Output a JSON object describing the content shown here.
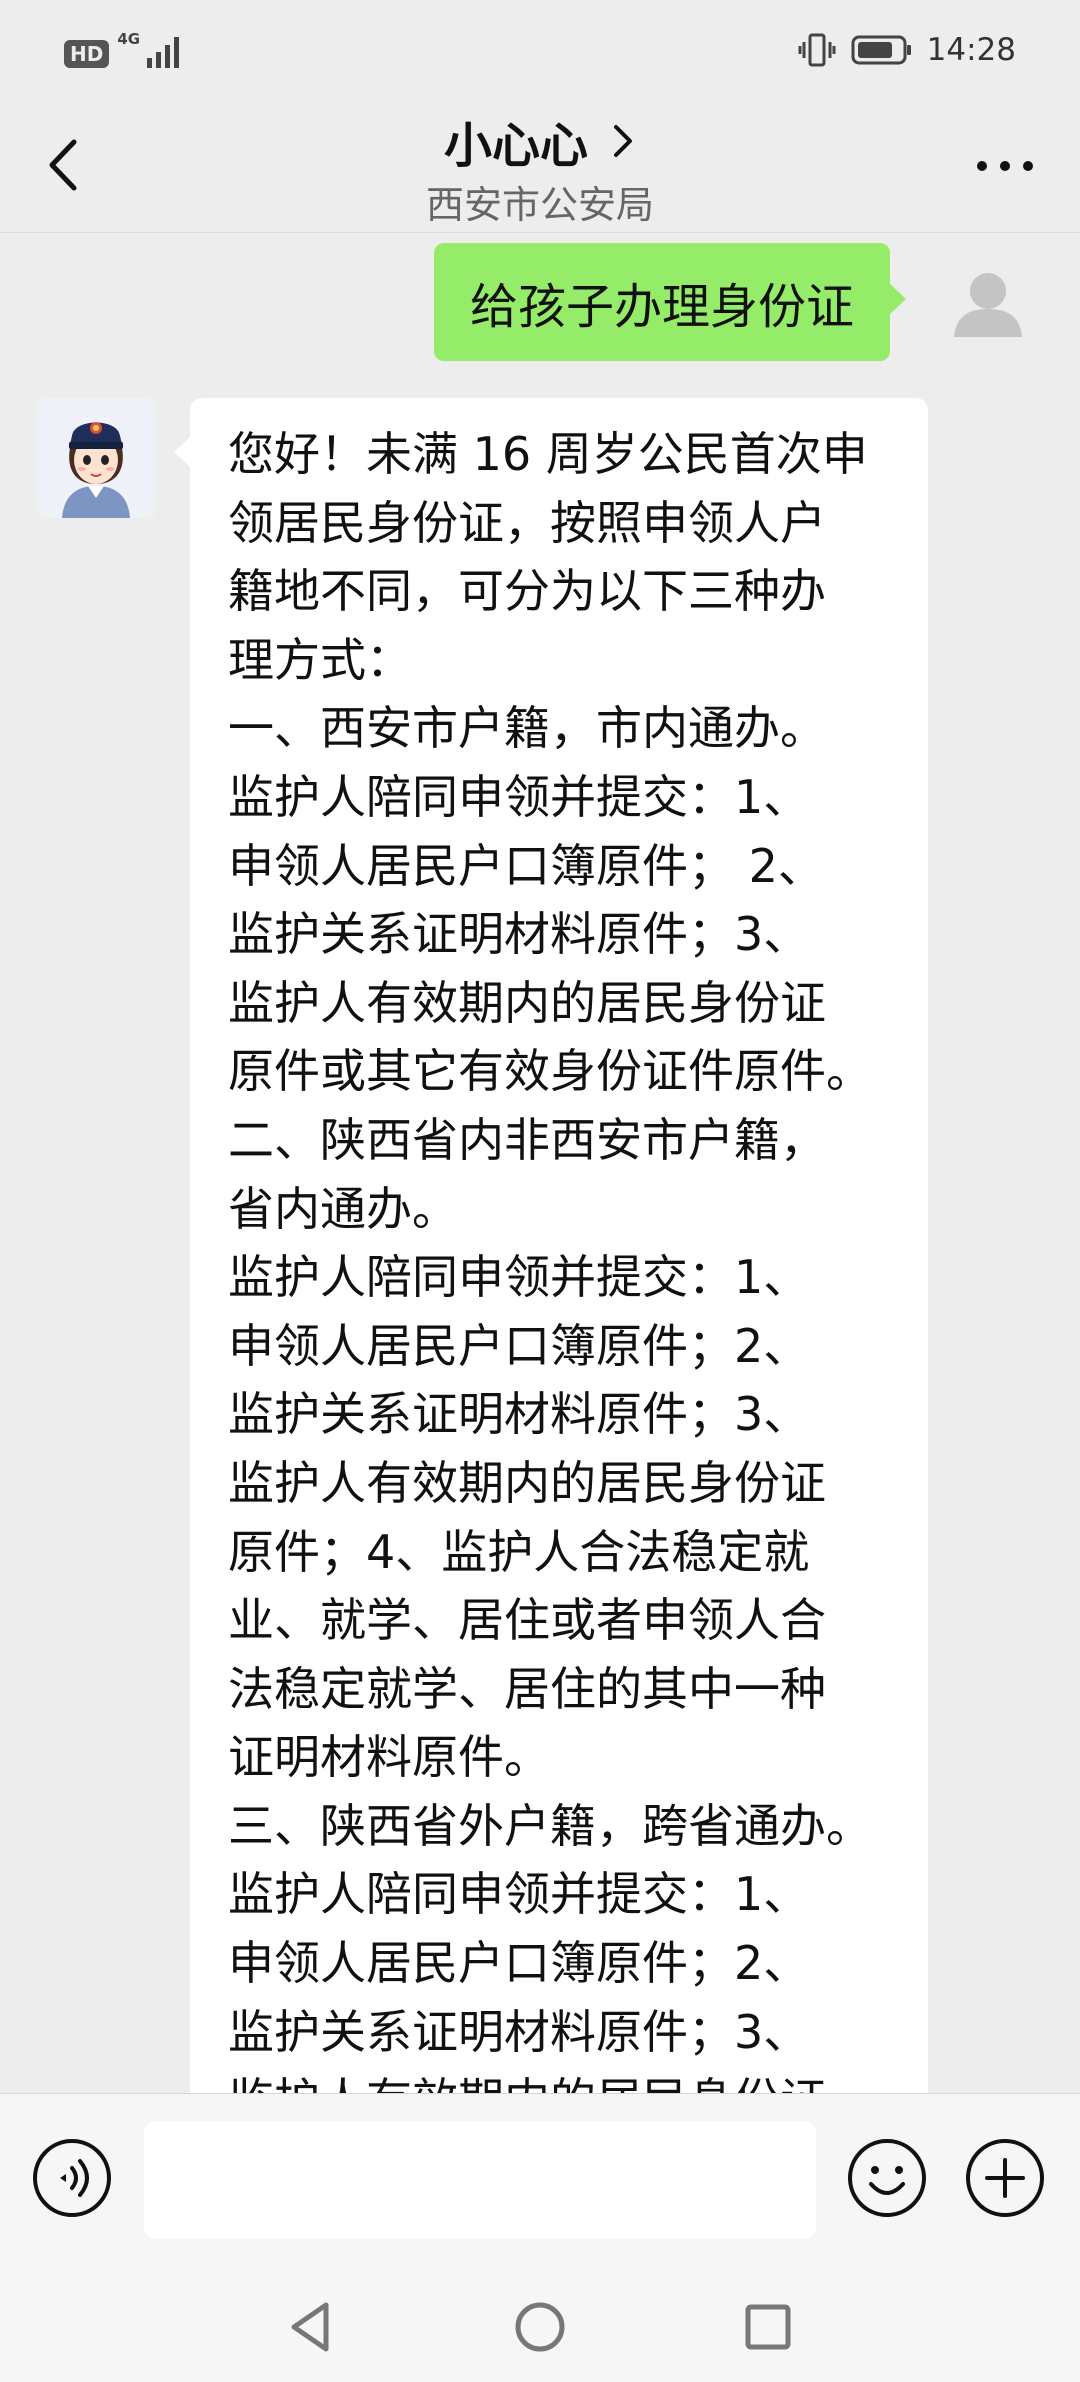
{
  "status_bar": {
    "hd_label": "HD",
    "network_label": "4G",
    "time": "14:28"
  },
  "header": {
    "title": "小心心",
    "subtitle": "西安市公安局"
  },
  "messages": {
    "outgoing_text": "给孩子办理身份证",
    "incoming_lines": [
      "您好！未满 16 周岁公民首次申",
      "领居民身份证，按照申领人户",
      "籍地不同，可分为以下三种办",
      "理方式：",
      "一、西安市户籍，市内通办。",
      "监护人陪同申领并提交：1、",
      "申领人居民户口簿原件；  2、",
      "监护关系证明材料原件；3、",
      "监护人有效期内的居民身份证",
      "原件或其它有效身份证件原件。",
      "二、陕西省内非西安市户籍，",
      "省内通办。",
      "监护人陪同申领并提交：1、",
      "申领人居民户口簿原件；2、",
      "监护关系证明材料原件；3、",
      "监护人有效期内的居民身份证",
      "原件；4、监护人合法稳定就",
      "业、就学、居住或者申领人合",
      "法稳定就学、居住的其中一种",
      "证明材料原件。",
      "三、陕西省外户籍，跨省通办。",
      "监护人陪同申领并提交：1、",
      "申领人居民户口簿原件；2、",
      "监护关系证明材料原件；3、",
      "监护人有效期内的居民身份证"
    ]
  },
  "input": {
    "value": ""
  },
  "icons": {
    "back": "chevron-left-icon",
    "title_arrow": "chevron-right-icon",
    "more": "more-dots-icon",
    "voice": "voice-icon",
    "emoji": "emoji-icon",
    "plus": "plus-icon",
    "nav_back": "triangle-back-icon",
    "nav_home": "circle-home-icon",
    "nav_recent": "square-recent-icon"
  },
  "colors": {
    "background": "#ededed",
    "outgoing_bubble": "#95ec69",
    "incoming_bubble": "#ffffff",
    "input_bar": "#f6f6f6"
  }
}
